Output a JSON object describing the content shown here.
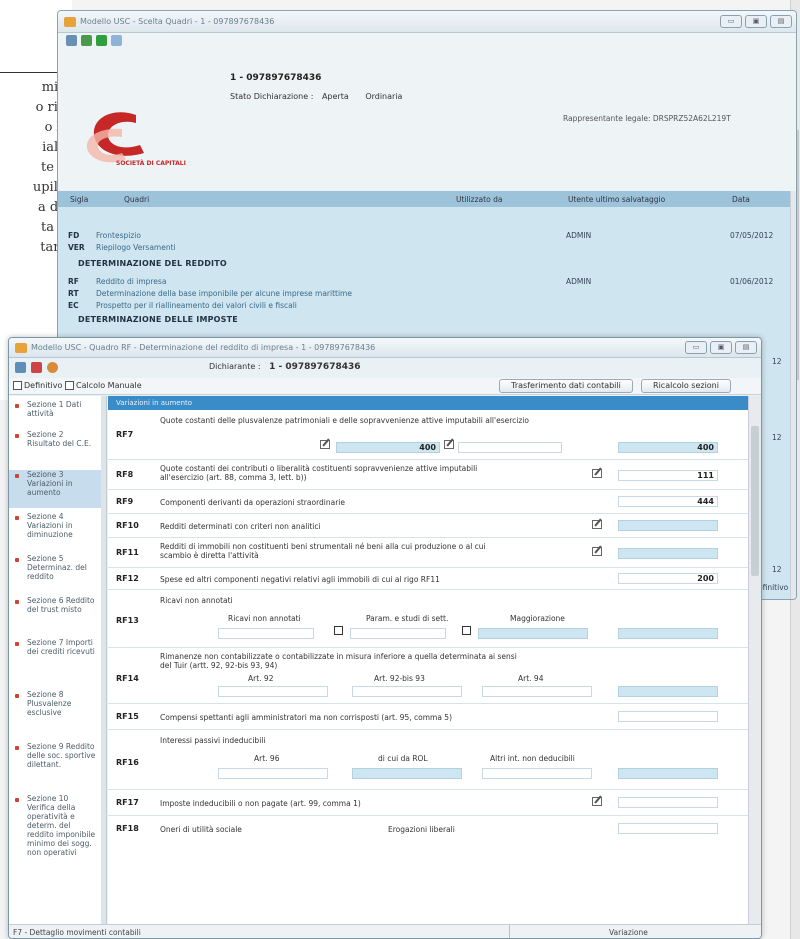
{
  "background_text": {
    "lines": [
      "mi e",
      "o rie-",
      "o X,",
      "iale.",
      "te la",
      "upila-",
      "a dei",
      "ta la",
      "tam-"
    ]
  },
  "win1": {
    "title": "Modello USC - Scelta Quadri - 1 - 097897678436",
    "logo_text": "SOCIETÀ DI CAPITALI",
    "declaration_id": "1 - 097897678436",
    "stato_label": "Stato Dichiarazione :",
    "stato_value": "Aperta",
    "tipo": "Ordinaria",
    "rapp_label": "Rappresentante legale: DRSPRZ52A62L219T",
    "columns": [
      "Sigla",
      "Quadri",
      "Utilizzato da",
      "Utente ultimo salvataggio",
      "Data"
    ],
    "rows": [
      {
        "sigla": "FD",
        "quadro": "Frontespizio",
        "utente": "ADMIN",
        "data": "07/05/2012"
      },
      {
        "sigla": "VER",
        "quadro": "Riepilogo Versamenti",
        "utente": "",
        "data": ""
      },
      {
        "section": "DETERMINAZIONE DEL REDDITO"
      },
      {
        "sigla": "RF",
        "quadro": "Reddito di impresa",
        "utente": "ADMIN",
        "data": "01/06/2012"
      },
      {
        "sigla": "RT",
        "quadro": "Determinazione della base imponibile per alcune imprese marittime",
        "utente": "",
        "data": ""
      },
      {
        "sigla": "EC",
        "quadro": "Prospetto per il riallineamento dei valori civili e fiscali",
        "utente": "",
        "data": ""
      },
      {
        "section": "DETERMINAZIONE DELLE IMPOSTE"
      }
    ],
    "right_partial": [
      "12",
      "12",
      "12"
    ],
    "right_edge_text": "efinitivo"
  },
  "win2": {
    "title": "Modello USC - Quadro RF - Determinazione del reddito di impresa - 1 - 097897678436",
    "dichiarante_label": "Dichiarante :",
    "dichiarante_value": "1 - 097897678436",
    "check_definitivo": "Definitivo",
    "check_calcolo": "Calcolo Manuale",
    "btn_trasf": "Trasferimento dati contabili",
    "btn_ricalc": "Ricalcolo sezioni",
    "section_header": "Variazioni in aumento",
    "nav": [
      "Sezione 1 Dati attività",
      "Sezione 2 Risultato del C.E.",
      "Sezione 3 Variazioni in aumento",
      "Sezione 4 Variazioni in diminuzione",
      "Sezione 5 Determinaz. del reddito",
      "Sezione 6 Reddito del trust misto",
      "Sezione 7 Importi dei crediti ricevuti",
      "Sezione 8 Plusvalenze esclusive",
      "Sezione 9 Reddito delle soc. sportive dilettant.",
      "Sezione 10 Verifica della operatività e determ. del reddito imponibile minimo dei sogg. non operativi"
    ],
    "rows": {
      "rf7": {
        "code": "RF7",
        "desc": "Quote costanti delle plusvalenze patrimoniali e delle sopravvenienze attive imputabili all'esercizio",
        "v1": "400",
        "v2": "400"
      },
      "rf8": {
        "code": "RF8",
        "desc1": "Quote costanti dei contributi o liberalità costituenti sopravvenienze attive imputabili",
        "desc2": "all'esercizio (art. 88, comma 3, lett. b))",
        "val": "111"
      },
      "rf9": {
        "code": "RF9",
        "desc": "Componenti derivanti da operazioni straordinarie",
        "val": "444"
      },
      "rf10": {
        "code": "RF10",
        "desc": "Redditi determinati con criteri non analitici"
      },
      "rf11": {
        "code": "RF11",
        "desc1": "Redditi di immobili non costituenti beni strumentali né beni alla cui produzione o al cui",
        "desc2": "scambio è diretta l'attività"
      },
      "rf12": {
        "code": "RF12",
        "desc": "Spese ed altri componenti negativi relativi agli immobili di cui al rigo RF11",
        "val": "200"
      },
      "rf13": {
        "code": "RF13",
        "desc": "Ricavi non annotati",
        "sub1": "Ricavi non annotati",
        "sub2": "Param. e studi di sett.",
        "sub3": "Maggiorazione"
      },
      "rf14": {
        "code": "RF14",
        "desc1": "Rimanenze non contabilizzate o contabilizzate in misura inferiore a quella determinata ai sensi",
        "desc2": "del Tuir (artt. 92, 92-bis 93, 94)",
        "sub1": "Art. 92",
        "sub2": "Art. 92-bis 93",
        "sub3": "Art. 94"
      },
      "rf15": {
        "code": "RF15",
        "desc": "Compensi spettanti agli amministratori ma non corrisposti (art. 95, comma 5)"
      },
      "rf16": {
        "code": "RF16",
        "desc": "Interessi passivi indeducibili",
        "sub1": "Art. 96",
        "sub2": "di cui da ROL",
        "sub3": "Altri int. non deducibili"
      },
      "rf17": {
        "code": "RF17",
        "desc": "Imposte indeducibili o non pagate (art. 99, comma 1)"
      },
      "rf18": {
        "code": "RF18",
        "desc": "Oneri di utilità sociale",
        "sub": "Erogazioni liberali"
      }
    },
    "status_left": "F7 - Dettaglio movimenti contabili",
    "status_right": "Variazione"
  },
  "colors": {
    "accent": "#3a8cc8",
    "table_bg": "#cfe5ef",
    "header_blue": "#9cc3d9",
    "logo_red": "#c62828"
  }
}
